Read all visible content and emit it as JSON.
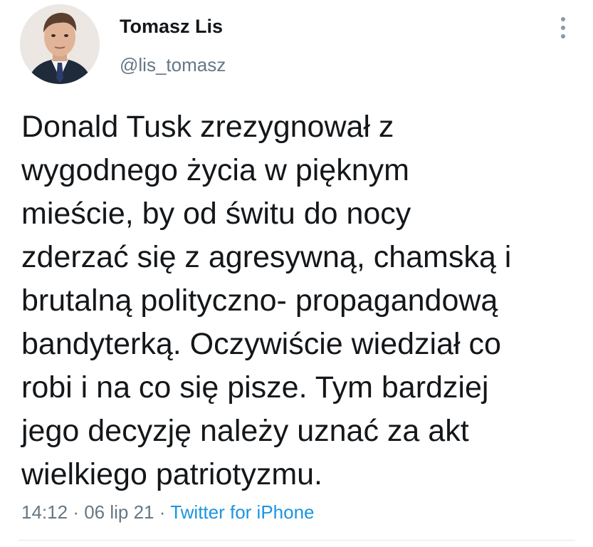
{
  "author": {
    "name": "Tomasz Lis",
    "handle": "@lis_tomasz"
  },
  "tweet": {
    "text": "Donald Tusk zrezygnował z\nwygodnego życia w pięknym\nmieście, by od świtu do nocy\nzderzać się z agresywną, chamską i\nbrutalną polityczno- propagandową\nbandyterką. Oczywiście wiedział co\nrobi i na co się pisze. Tym bardziej\njego decyzję należy uznać za akt\nwielkiego patriotyzmu.",
    "time": "14:12",
    "separator": "·",
    "date": "06 lip 21",
    "source": "Twitter for iPhone"
  },
  "icons": {
    "more": "more-vertical-icon"
  },
  "colors": {
    "text": "#14171a",
    "secondary": "#657786",
    "link": "#1b95e0",
    "divider": "#e1e8ed"
  }
}
